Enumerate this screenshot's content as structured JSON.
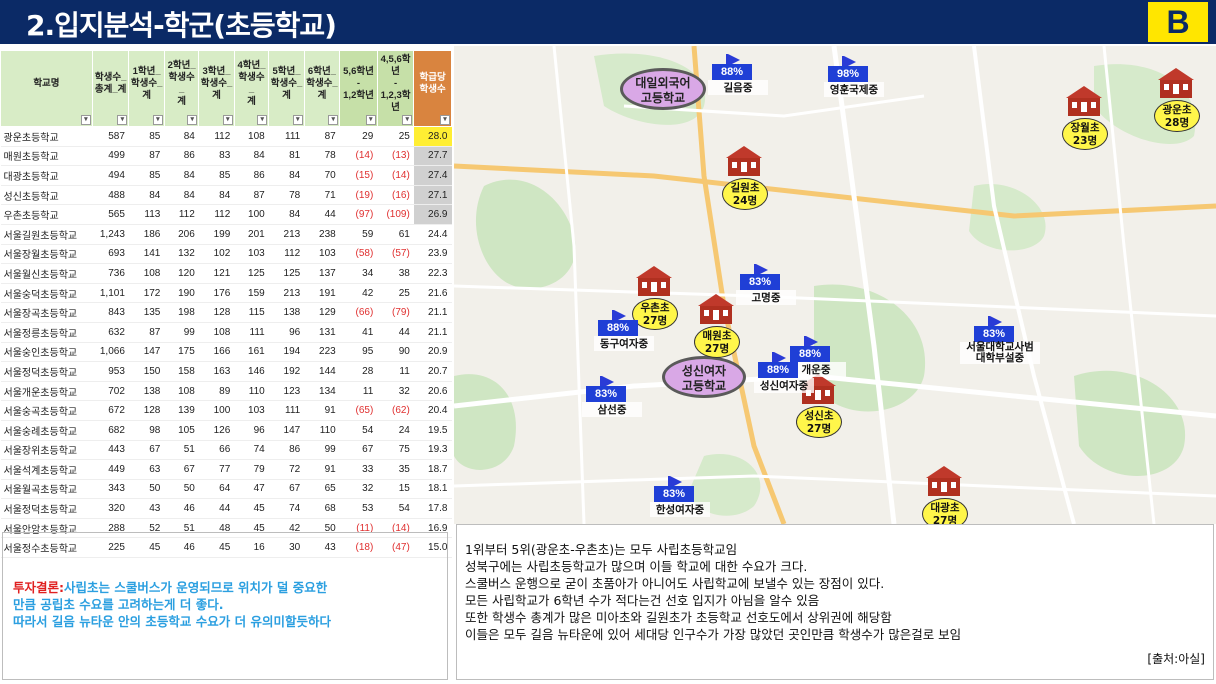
{
  "header": {
    "title": "2.입지분석-학군(초등학교)",
    "badge": "B"
  },
  "table": {
    "columns": [
      "학교명",
      "학생수_\n총계_계",
      "1학년_\n학생수_\n계",
      "2학년_\n학생수_\n계",
      "3학년_\n학생수_\n계",
      "4학년_\n학생수_\n계",
      "5학년_\n학생수_\n계",
      "6학년_\n학생수_\n계",
      "5,6학년\n-\n1,2학년",
      "4,5,6학\n년\n-\n1,2,3학\n년",
      "학급당\n학생수"
    ],
    "rows": [
      [
        "광운초등학교",
        "587",
        "85",
        "84",
        "112",
        "108",
        "111",
        "87",
        "29",
        "25",
        "28.0"
      ],
      [
        "매원초등학교",
        "499",
        "87",
        "86",
        "83",
        "84",
        "81",
        "78",
        "(14)",
        "(13)",
        "27.7"
      ],
      [
        "대광초등학교",
        "494",
        "85",
        "84",
        "85",
        "86",
        "84",
        "70",
        "(15)",
        "(14)",
        "27.4"
      ],
      [
        "성신초등학교",
        "488",
        "84",
        "84",
        "84",
        "87",
        "78",
        "71",
        "(19)",
        "(16)",
        "27.1"
      ],
      [
        "우촌초등학교",
        "565",
        "113",
        "112",
        "112",
        "100",
        "84",
        "44",
        "(97)",
        "(109)",
        "26.9"
      ],
      [
        "서울길원초등학교",
        "1,243",
        "186",
        "206",
        "199",
        "201",
        "213",
        "238",
        "59",
        "61",
        "24.4"
      ],
      [
        "서울장월초등학교",
        "693",
        "141",
        "132",
        "102",
        "103",
        "112",
        "103",
        "(58)",
        "(57)",
        "23.9"
      ],
      [
        "서울월신초등학교",
        "736",
        "108",
        "120",
        "121",
        "125",
        "125",
        "137",
        "34",
        "38",
        "22.3"
      ],
      [
        "서울숭덕초등학교",
        "1,101",
        "172",
        "190",
        "176",
        "159",
        "213",
        "191",
        "42",
        "25",
        "21.6"
      ],
      [
        "서울장곡초등학교",
        "843",
        "135",
        "198",
        "128",
        "115",
        "138",
        "129",
        "(66)",
        "(79)",
        "21.1"
      ],
      [
        "서울정릉초등학교",
        "632",
        "87",
        "99",
        "108",
        "111",
        "96",
        "131",
        "41",
        "44",
        "21.1"
      ],
      [
        "서울숭인초등학교",
        "1,066",
        "147",
        "175",
        "166",
        "161",
        "194",
        "223",
        "95",
        "90",
        "20.9"
      ],
      [
        "서울정덕초등학교",
        "953",
        "150",
        "158",
        "163",
        "146",
        "192",
        "144",
        "28",
        "11",
        "20.7"
      ],
      [
        "서울개운초등학교",
        "702",
        "138",
        "108",
        "89",
        "110",
        "123",
        "134",
        "11",
        "32",
        "20.6"
      ],
      [
        "서울숭곡초등학교",
        "672",
        "128",
        "139",
        "100",
        "103",
        "111",
        "91",
        "(65)",
        "(62)",
        "20.4"
      ],
      [
        "서울숭례초등학교",
        "682",
        "98",
        "105",
        "126",
        "96",
        "147",
        "110",
        "54",
        "24",
        "19.5"
      ],
      [
        "서울장위초등학교",
        "443",
        "67",
        "51",
        "66",
        "74",
        "86",
        "99",
        "67",
        "75",
        "19.3"
      ],
      [
        "서울석계초등학교",
        "449",
        "63",
        "67",
        "77",
        "79",
        "72",
        "91",
        "33",
        "35",
        "18.7"
      ],
      [
        "서울월곡초등학교",
        "343",
        "50",
        "50",
        "64",
        "47",
        "67",
        "65",
        "32",
        "15",
        "18.1"
      ],
      [
        "서울정덕초등학교",
        "320",
        "43",
        "46",
        "44",
        "45",
        "74",
        "68",
        "53",
        "54",
        "17.8"
      ],
      [
        "서울안암초등학교",
        "288",
        "52",
        "51",
        "48",
        "45",
        "42",
        "50",
        "(11)",
        "(14)",
        "16.9"
      ],
      [
        "서울정수초등학교",
        "225",
        "45",
        "46",
        "45",
        "16",
        "30",
        "43",
        "(18)",
        "(47)",
        "15.0"
      ]
    ]
  },
  "map": {
    "ovals": [
      {
        "name": "대일외국어\n고등학교"
      },
      {
        "name": "성신여자\n고등학교"
      }
    ],
    "schools": [
      {
        "name": "광운초",
        "count": "28명"
      },
      {
        "name": "장월초",
        "count": "23명"
      },
      {
        "name": "길원초",
        "count": "24명"
      },
      {
        "name": "우촌초",
        "count": "27명"
      },
      {
        "name": "매원초",
        "count": "27명"
      },
      {
        "name": "성신초",
        "count": "27명"
      },
      {
        "name": "대광초",
        "count": "27명"
      }
    ],
    "flags": [
      {
        "pct": "88%",
        "name": "길음중"
      },
      {
        "pct": "98%",
        "name": "영훈국제중"
      },
      {
        "pct": "83%",
        "name": "고명중"
      },
      {
        "pct": "88%",
        "name": "동구여자중"
      },
      {
        "pct": "88%",
        "name": "개운중"
      },
      {
        "pct": "88%",
        "name": "성신여자중"
      },
      {
        "pct": "83%",
        "name": "서울대학교사범\n대학부설중"
      },
      {
        "pct": "83%",
        "name": "삼선중"
      },
      {
        "pct": "83%",
        "name": "한성여자중"
      }
    ],
    "colors": {
      "flag": "#1f3fd6",
      "label": "#fff64a",
      "oval": "#d9a8e6",
      "school_roof": "#c0392b"
    }
  },
  "conclusion": {
    "heading": "투자결론:",
    "line1": "사립초는 스쿨버스가 운영되므로 위치가 덜 중요한",
    "line2": "만큼 공립초 수요를 고려하는게 더 좋다.",
    "line3": "따라서 길음 뉴타운 안의 초등학교 수요가 더 유의미할듯하다"
  },
  "notes": {
    "lines": [
      "1위부터 5위(광운초-우촌초)는 모두 사립초등학교임",
      "성북구에는 사립초등학교가 많으며 이들 학교에 대한 수요가 크다.",
      "스쿨버스 운행으로 굳이 초품아가 아니어도 사립학교에 보낼수 있는 장점이 있다.",
      "모든 사립학교가 6학년 수가 적다는건 선호 입지가 아님을 알수 있음",
      "또한 학생수 총계가 많은 미아초와 길원초가 초등학교 선호도에서 상위권에 해당함",
      "이들은 모두 길음 뉴타운에 있어 세대당 인구수가 가장 많았던 곳인만큼 학생수가 많은걸로 보임"
    ],
    "source": "[출처:아실]"
  }
}
